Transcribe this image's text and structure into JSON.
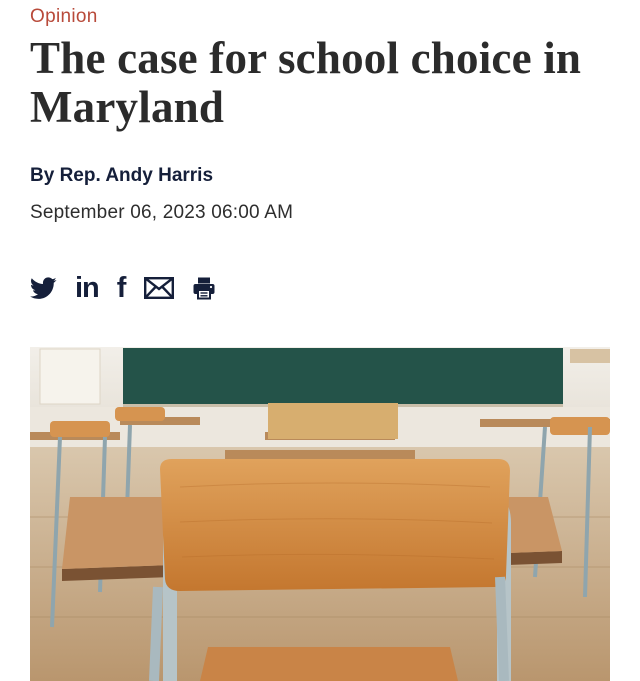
{
  "article": {
    "category": "Opinion",
    "headline": "The case for school choice in Maryland",
    "byline": "By Rep. Andy Harris",
    "date": "September 06, 2023 06:00 AM"
  },
  "share": {
    "twitter_icon": "twitter-icon",
    "linkedin_icon": "linkedin-icon",
    "linkedin_glyph": "in",
    "facebook_icon": "facebook-icon",
    "facebook_glyph": "f",
    "email_icon": "email-icon",
    "print_icon": "print-icon"
  },
  "hero_image": {
    "subject": "empty classroom desks and chairs"
  },
  "colors": {
    "category": "#b84a3a",
    "headline": "#2b2b2b",
    "byline": "#151f3a",
    "icons": "#151f3a"
  }
}
